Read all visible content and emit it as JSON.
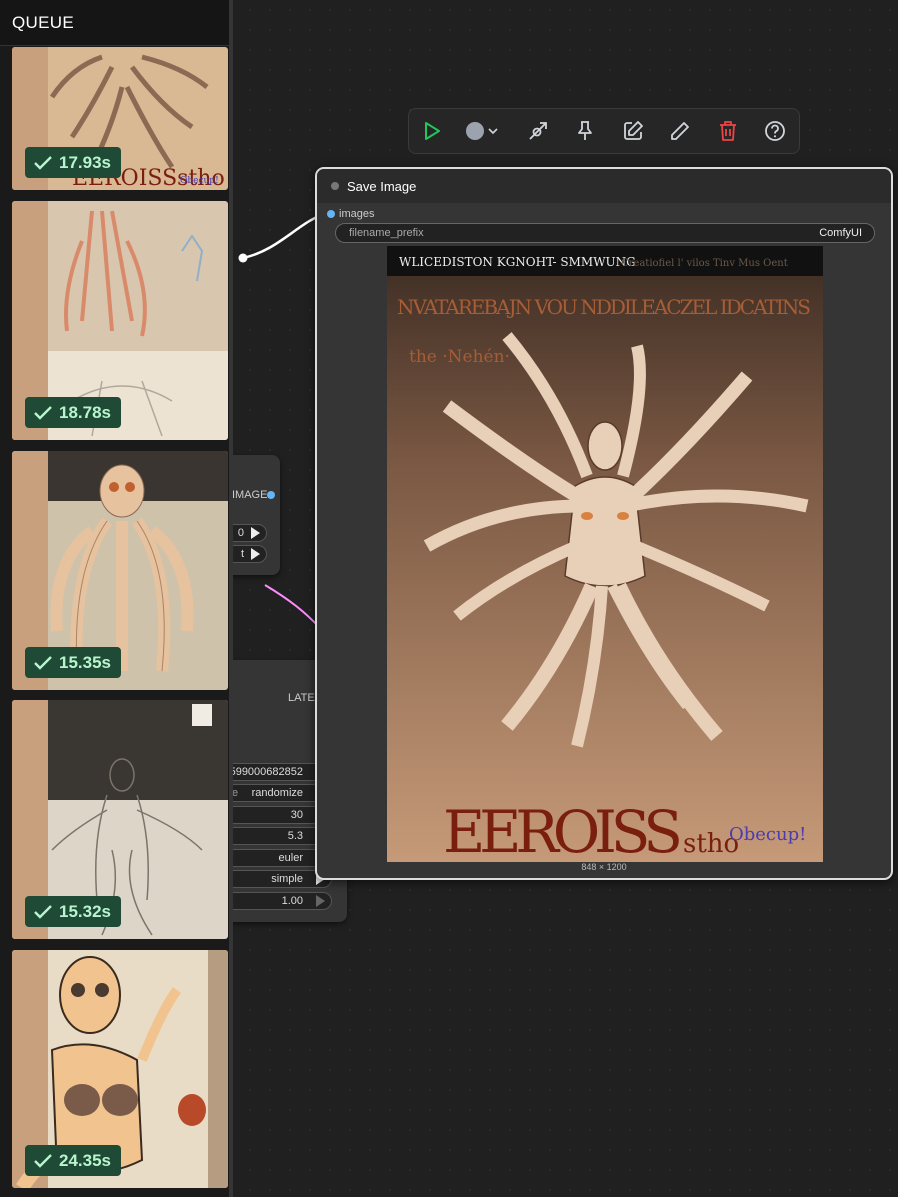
{
  "sidebar": {
    "title": "QUEUE",
    "items": [
      {
        "duration": "17.93s",
        "caption_top": "",
        "caption_bottom": "EEROISSstho",
        "signature": "Obecup!"
      },
      {
        "duration": "18.78s",
        "caption_top": "",
        "caption_bottom": "",
        "signature": ""
      },
      {
        "duration": "15.35s",
        "caption_top": "",
        "caption_bottom": "",
        "signature": ""
      },
      {
        "duration": "15.32s",
        "caption_top": "",
        "caption_bottom": "",
        "signature": ""
      },
      {
        "duration": "24.35s",
        "caption_top": "",
        "caption_bottom": "",
        "signature": ""
      }
    ]
  },
  "toolbar": {
    "buttons": [
      {
        "icon": "play-icon",
        "color": "#22c55e"
      },
      {
        "icon": "color-circle-icon",
        "color": "#9ca3af"
      },
      {
        "icon": "bypass-icon",
        "color": "#d1d5db"
      },
      {
        "icon": "pin-icon",
        "color": "#d1d5db"
      },
      {
        "icon": "edit-square-icon",
        "color": "#d1d5db"
      },
      {
        "icon": "pencil-icon",
        "color": "#d1d5db"
      },
      {
        "icon": "trash-icon",
        "color": "#ef4444"
      },
      {
        "icon": "help-icon",
        "color": "#d1d5db"
      }
    ]
  },
  "decoder_node": {
    "output_label": "IMAGE",
    "widget_values": [
      "0",
      "t"
    ]
  },
  "sampler_node": {
    "output_label": "LATENT",
    "widgets": [
      {
        "label": "",
        "value": "599000682852"
      },
      {
        "label": "e",
        "value": "randomize"
      },
      {
        "label": "",
        "value": "30"
      },
      {
        "label": "",
        "value": "5.3"
      },
      {
        "label": "",
        "value": "euler"
      },
      {
        "label": "",
        "value": "simple"
      },
      {
        "label": "",
        "value": "1.00"
      }
    ]
  },
  "save_image_node": {
    "title": "Save Image",
    "input_label": "images",
    "prefix_key": "filename_prefix",
    "prefix_value": "ComfyUI",
    "dimensions": "848 × 1200",
    "preview_text": {
      "header": "WLICEDISTON   KGNOHT-   SMMWUNG",
      "header_right": "Creatiofiel  l'  vilos  Tinv  Mus  Oent",
      "subtitle": "NVATAREBAJN VOU NDDILEACZEL IDCATINS",
      "tag": "the ·Nehén·",
      "bottom": "EEROISS",
      "bottom_small": "stho",
      "signature": "Obecup!"
    }
  },
  "colors": {
    "badge_bg": "#1f4a35",
    "badge_text": "#b8f5cf",
    "link_latent": "#ff8cff",
    "link_image": "#64b5f6"
  }
}
